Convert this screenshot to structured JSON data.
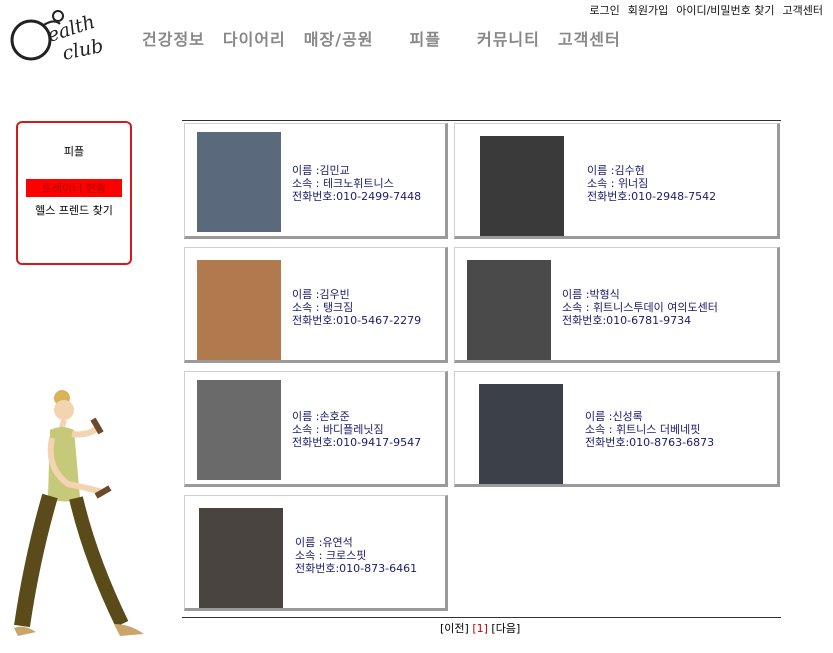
{
  "logo": {
    "text": "Health club"
  },
  "utility": [
    "로그인",
    "회원가입",
    "아이디/비밀번호 찾기",
    "고객센터"
  ],
  "nav": [
    "건강정보",
    "다이어리",
    "매장/공원",
    "피플",
    "커뮤니티",
    "고객센터"
  ],
  "sidebar": {
    "title": "피플",
    "items": [
      "트레이너 현황",
      "헬스 프렌드 찾기"
    ]
  },
  "trainers": [
    {
      "name": "이름 :김민교",
      "club": "소속 : 테크노휘트니스",
      "phone": "전화번호:010-2499-7448"
    },
    {
      "name": "이름 :김수현",
      "club": "소속 : 위너짐",
      "phone": "전화번호:010-2948-7542"
    },
    {
      "name": "이름 :김우빈",
      "club": "소속 : 탱크짐",
      "phone": "전화번호:010-5467-2279"
    },
    {
      "name": "이름 :박형식",
      "club": "소속 : 휘트니스투데이 여의도센터",
      "phone": "전화번호:010-6781-9734"
    },
    {
      "name": "이름 :손호준",
      "club": "소속 : 바디플레닛짐",
      "phone": "전화번호:010-9417-9547"
    },
    {
      "name": "이름 :신성록",
      "club": "소속 : 휘트니스 더베네핏",
      "phone": "전화번호:010-8763-6873"
    },
    {
      "name": "이름 :유연석",
      "club": "소속 : 크로스핏",
      "phone": "전화번호:010-873-6461"
    }
  ],
  "pager": {
    "prev": "[이전]",
    "current": "[1]",
    "next": "[다음]"
  }
}
